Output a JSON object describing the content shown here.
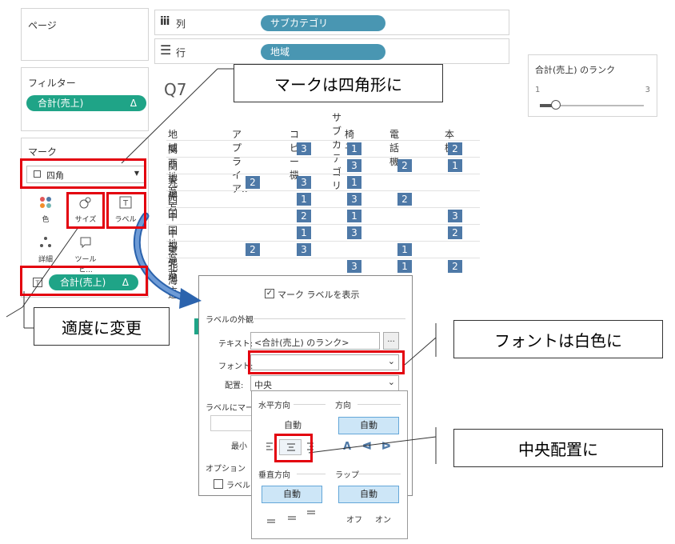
{
  "pages_panel": {
    "title": "ページ"
  },
  "filters_panel": {
    "title": "フィルター",
    "pill_label": "合計(売上)",
    "pill_delta": "Δ"
  },
  "marks_panel": {
    "title": "マーク",
    "mark_type": "四角",
    "buttons": {
      "color": "色",
      "size": "サイズ",
      "label": "ラベル",
      "detail": "詳細",
      "tooltip": "ツールヒ..."
    },
    "pill_label": "合計(売上)",
    "pill_delta": "Δ"
  },
  "shelves": {
    "columns": {
      "label": "列",
      "pill": "サブカテゴリ"
    },
    "rows": {
      "label": "行",
      "pill": "地域"
    }
  },
  "sheet_title_fragment": "Q7",
  "legend": {
    "title": "合計(売上) のランク",
    "min": "1",
    "max": "3",
    "value_fraction": 0.15
  },
  "table": {
    "column_group_header": "サブカテゴリ",
    "row_header": "地域",
    "columns": [
      "アプライア..",
      "コピー機",
      "椅子",
      "電話機",
      "本棚"
    ],
    "rows": [
      {
        "label": "関西地方",
        "values": [
          "",
          "3",
          "1",
          "",
          "2"
        ]
      },
      {
        "label": "関東地方",
        "values": [
          "",
          "",
          "3",
          "2",
          "1"
        ]
      },
      {
        "label": "九州",
        "values": [
          "2",
          "3",
          "1",
          "",
          ""
        ]
      },
      {
        "label": "四国",
        "values": [
          "",
          "1",
          "3",
          "2",
          ""
        ]
      },
      {
        "label": "中国地方",
        "values": [
          "",
          "2",
          "1",
          "",
          "3"
        ]
      },
      {
        "label": "中部地方",
        "values": [
          "",
          "1",
          "3",
          "",
          "2"
        ]
      },
      {
        "label": "東北地方",
        "values": [
          "2",
          "3",
          "",
          "1",
          ""
        ]
      },
      {
        "label": "北海道",
        "values": [
          "",
          "",
          "3",
          "1",
          "2"
        ]
      }
    ]
  },
  "label_dialog": {
    "show_labels_text": "マーク ラベルを表示",
    "appearance_section": "ラベルの外観",
    "text_label": "テキスト:",
    "text_value": "<合計(売上) のランク>",
    "ellipsis": "...",
    "font_label": "フォント:",
    "alignment_label": "配置:",
    "alignment_value": "中央",
    "marks_to_label_partial": "ラベルにマーク",
    "min_partial": "最小",
    "options_section": "オプション",
    "option_partial": "ラベル"
  },
  "alignment_popup": {
    "horizontal": "水平方向",
    "direction": "方向",
    "auto": "自動",
    "vertical": "垂直方向",
    "wrap": "ラップ",
    "off": "オフ",
    "on": "オン",
    "direction_glyph_a": "A"
  },
  "callouts": {
    "mark_square": "マークは四角形に",
    "adjust": "適度に変更",
    "font_white": "フォントは白色に",
    "center_align": "中央配置に"
  },
  "colors": {
    "green_pill": "#1fa487",
    "blue_pill": "#4996b2",
    "cell": "#4e79a7",
    "red": "#e3000f"
  }
}
